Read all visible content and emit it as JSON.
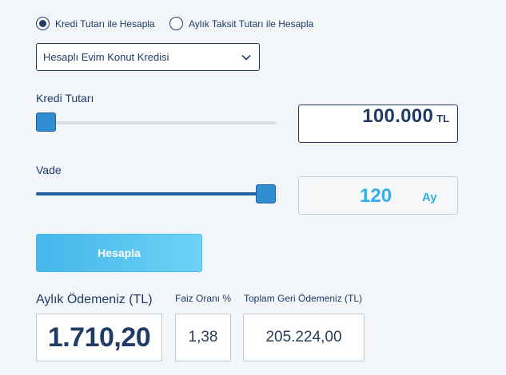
{
  "calc_mode": {
    "options": [
      {
        "label": "Kredi Tutarı ile Hesapla",
        "selected": true
      },
      {
        "label": "Aylık Taksit Tutarı ile Hesapla",
        "selected": false
      }
    ]
  },
  "loan_type": {
    "selected": "Hesaplı Evim Konut Kredisi",
    "icon": "chevron-down-icon"
  },
  "loan_amount": {
    "label": "Kredi Tutarı",
    "value": "100.000",
    "unit": "TL",
    "slider_level": 0.0
  },
  "term": {
    "label": "Vade",
    "value": "120",
    "unit": "Ay",
    "slider_level": 1.0
  },
  "calculate_button": {
    "label": "Hesapla"
  },
  "results": {
    "monthly_label": "Aylık Ödemeniz (TL)",
    "monthly_value": "1.710,20",
    "rate_label": "Faiz Oranı %",
    "rate_value": "1,38",
    "total_label": "Toplam Geri Ödemeniz (TL)",
    "total_value": "205.224,00"
  },
  "colors": {
    "primary": "#1f3b66",
    "accent": "#34aee6",
    "slider_thumb": "#2e8ed0",
    "background": "#f3f6f9"
  }
}
